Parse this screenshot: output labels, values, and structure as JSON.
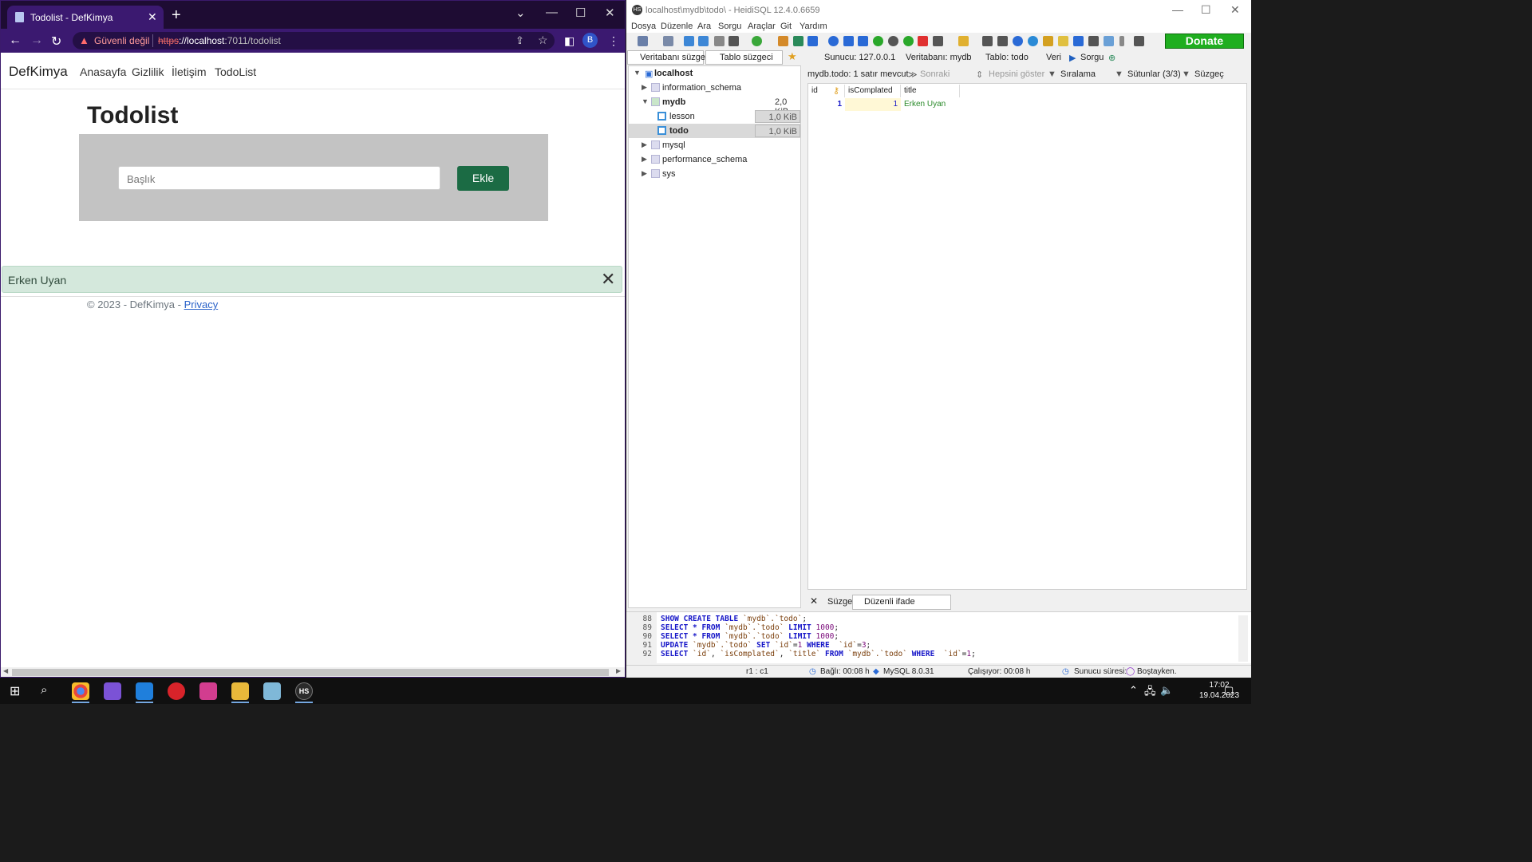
{
  "browser": {
    "tab_title": "Todolist - DefKimya",
    "new_tab": "+",
    "close_tab": "✕",
    "security_label": "Güvenli değil",
    "url_scheme": "https",
    "url_host": "://localhost",
    "url_rest": ":7011/todolist",
    "avatar_letter": "B"
  },
  "site": {
    "brand": "DefKimya",
    "nav": [
      "Anasayfa",
      "Gizlilik",
      "İletişim",
      "TodoList"
    ],
    "heading": "Todolist",
    "input_placeholder": "Başlık",
    "add_button": "Ekle",
    "alert_text": "Erken Uyan",
    "footer_text": "© 2023 - DefKimya - ",
    "footer_link": "Privacy"
  },
  "heidi": {
    "title": "localhost\\mydb\\todo\\ - HeidiSQL 12.4.0.6659",
    "menu": [
      "Dosya",
      "Düzenle",
      "Ara",
      "Sorgu",
      "Araçlar",
      "Git",
      "Yardım"
    ],
    "donate": "Donate",
    "db_filter": "Veritabanı süzgeci",
    "table_filter": "Tablo süzgeci",
    "tabs": [
      "Sunucu: 127.0.0.1",
      "Veritabanı: mydb",
      "Tablo: todo",
      "Veri",
      "Sorgu"
    ],
    "tree": {
      "root": "localhost",
      "dbs": [
        {
          "name": "information_schema"
        },
        {
          "name": "mydb",
          "size": "2,0 KiB"
        },
        {
          "name": "mysql"
        },
        {
          "name": "performance_schema"
        },
        {
          "name": "sys"
        }
      ],
      "tables": [
        {
          "name": "lesson",
          "size": "1,0 KiB"
        },
        {
          "name": "todo",
          "size": "1,0 KiB"
        }
      ]
    },
    "data_header": {
      "info": "mydb.todo: 1 satır mevcut",
      "next": "Sonraki",
      "show_all": "Hepsini göster",
      "sort": "Sıralama",
      "columns": "Sütunlar (3/3)",
      "filter": "Süzgeç"
    },
    "grid": {
      "columns": [
        "id",
        "isComplated",
        "title"
      ],
      "rows": [
        {
          "id": "1",
          "isComplated": "1",
          "title": "Erken Uyan"
        }
      ]
    },
    "filter_label": "Süzgeç:",
    "regex_placeholder": "Düzenli ifade",
    "sql_lines": [
      {
        "n": "88",
        "text": "SHOW CREATE TABLE `mydb`.`todo`;"
      },
      {
        "n": "89",
        "text": "SELECT * FROM `mydb`.`todo` LIMIT 1000;"
      },
      {
        "n": "90",
        "text": "SELECT * FROM `mydb`.`todo` LIMIT 1000;"
      },
      {
        "n": "91",
        "text": "UPDATE `mydb`.`todo` SET `id`=1 WHERE  `id`=3;"
      },
      {
        "n": "92",
        "text": "SELECT `id`, `isComplated`, `title` FROM `mydb`.`todo` WHERE  `id`=1;"
      }
    ],
    "status": {
      "pos": "r1 : c1",
      "connected": "Bağlı: 00:08 h",
      "version": "MySQL 8.0.31",
      "running": "Çalışıyor: 00:08 h",
      "server_time": "Sunucu süresi:",
      "idle": "Boştayken."
    }
  },
  "taskbar": {
    "time": "17:02",
    "date": "19.04.2023",
    "heidi_badge": "HS"
  }
}
